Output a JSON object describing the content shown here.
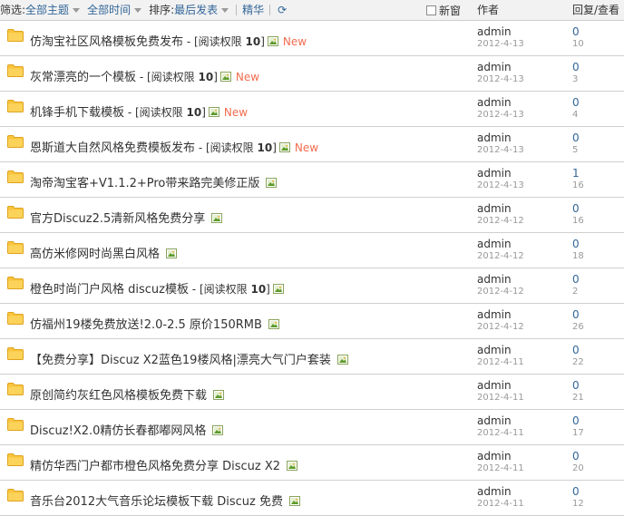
{
  "filter": {
    "label": "筛选:",
    "theme": "全部主题",
    "time": "全部时间",
    "sort_label": "排序:",
    "sort": "最后发表",
    "digest": "精华",
    "refresh_icon": "refresh-icon",
    "new_window": "新窗"
  },
  "columns": {
    "author": "作者",
    "replies": "回复/查看"
  },
  "threads": [
    {
      "title": "仿淘宝社区风格模板免费发布",
      "perm": "阅读权限",
      "perm_level": "10",
      "new": "New",
      "author": "admin",
      "date": "2012-4-13",
      "replies": "0",
      "views": "10"
    },
    {
      "title": "灰常漂亮的一个模板",
      "perm": "阅读权限",
      "perm_level": "10",
      "new": "New",
      "author": "admin",
      "date": "2012-4-13",
      "replies": "0",
      "views": "3"
    },
    {
      "title": "机锋手机下载模板",
      "perm": "阅读权限",
      "perm_level": "10",
      "new": "New",
      "author": "admin",
      "date": "2012-4-13",
      "replies": "0",
      "views": "4"
    },
    {
      "title": "恩斯道大自然风格免费模板发布",
      "perm": "阅读权限",
      "perm_level": "10",
      "new": "New",
      "author": "admin",
      "date": "2012-4-13",
      "replies": "0",
      "views": "5"
    },
    {
      "title": "淘帝淘宝客+V1.1.2+Pro带来路完美修正版",
      "perm": "",
      "perm_level": "",
      "new": "",
      "author": "admin",
      "date": "2012-4-13",
      "replies": "1",
      "views": "16"
    },
    {
      "title": "官方Discuz2.5清新风格免费分享",
      "perm": "",
      "perm_level": "",
      "new": "",
      "author": "admin",
      "date": "2012-4-12",
      "replies": "0",
      "views": "16"
    },
    {
      "title": "高仿米修网时尚黑白风格",
      "perm": "",
      "perm_level": "",
      "new": "",
      "author": "admin",
      "date": "2012-4-12",
      "replies": "0",
      "views": "18"
    },
    {
      "title": "橙色时尚门户风格 discuz模板",
      "perm": "阅读权限",
      "perm_level": "10",
      "new": "",
      "author": "admin",
      "date": "2012-4-12",
      "replies": "0",
      "views": "2"
    },
    {
      "title": "仿福州19楼免费放送!2.0-2.5 原价150RMB",
      "perm": "",
      "perm_level": "",
      "new": "",
      "author": "admin",
      "date": "2012-4-12",
      "replies": "0",
      "views": "26"
    },
    {
      "title": "【免费分享】Discuz X2蓝色19楼风格|漂亮大气门户套装",
      "perm": "",
      "perm_level": "",
      "new": "",
      "author": "admin",
      "date": "2012-4-11",
      "replies": "0",
      "views": "22"
    },
    {
      "title": "原创简约灰红色风格模板免费下载",
      "perm": "",
      "perm_level": "",
      "new": "",
      "author": "admin",
      "date": "2012-4-11",
      "replies": "0",
      "views": "21"
    },
    {
      "title": "Discuz!X2.0精仿长春都嘟网风格",
      "perm": "",
      "perm_level": "",
      "new": "",
      "author": "admin",
      "date": "2012-4-11",
      "replies": "0",
      "views": "17"
    },
    {
      "title": "精仿华西门户都市橙色风格免费分享 Discuz X2",
      "perm": "",
      "perm_level": "",
      "new": "",
      "author": "admin",
      "date": "2012-4-11",
      "replies": "0",
      "views": "20"
    },
    {
      "title": "音乐台2012大气音乐论坛模板下载 Discuz 免费",
      "perm": "",
      "perm_level": "",
      "new": "",
      "author": "admin",
      "date": "2012-4-11",
      "replies": "0",
      "views": "12"
    }
  ]
}
